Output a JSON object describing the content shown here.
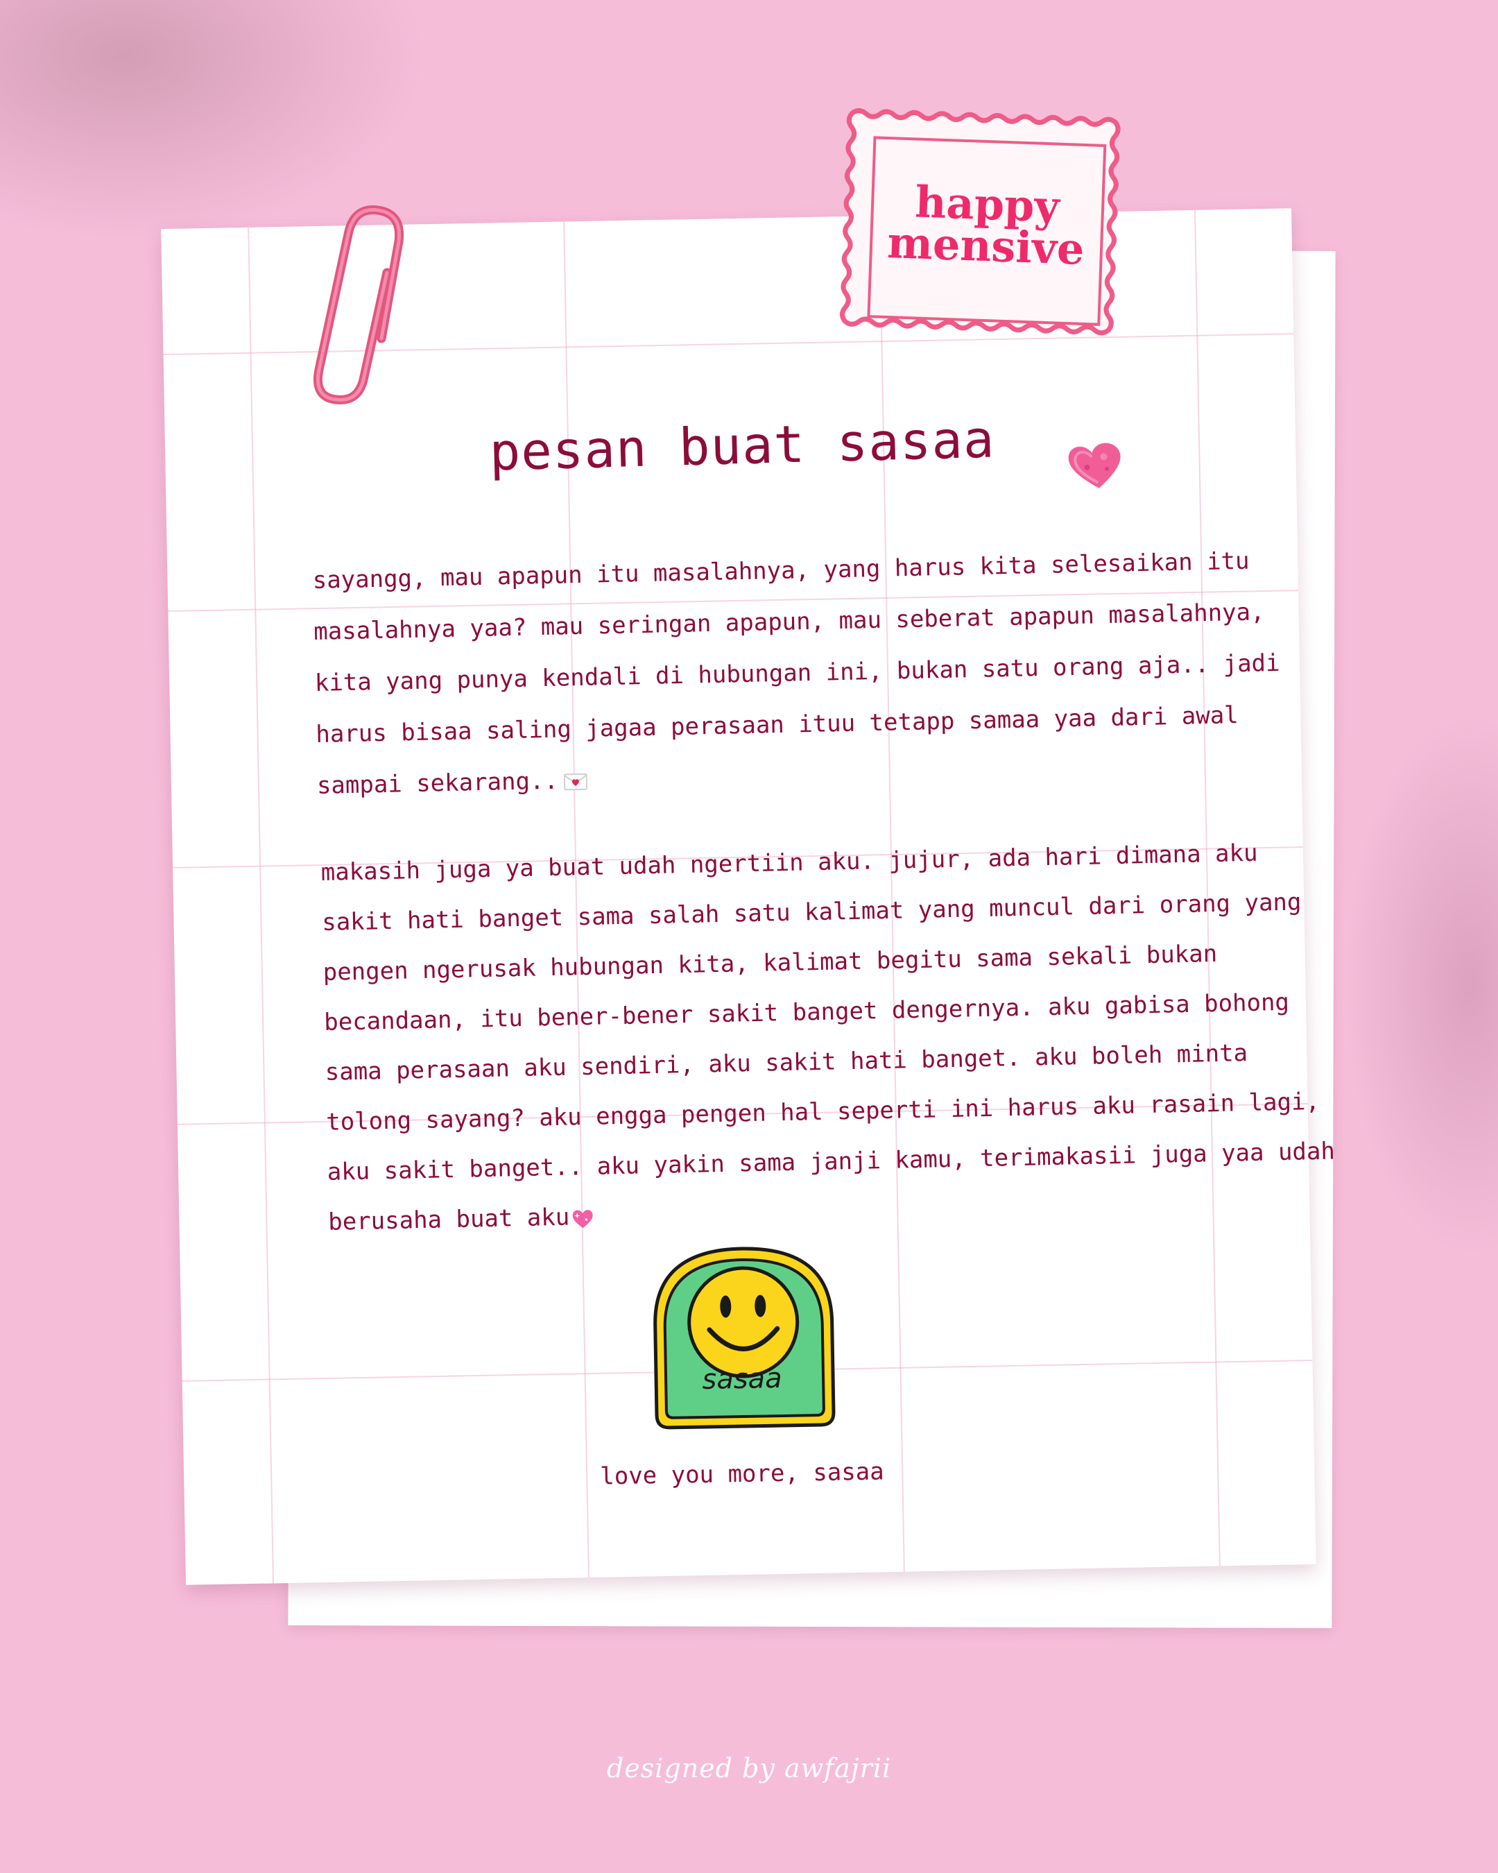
{
  "stamp": {
    "line1": "happy",
    "line2": "mensive",
    "color": "#ee2a6a"
  },
  "title": "pesan buat sasaa",
  "paragraph1": [
    "sayangg, mau apapun itu masalahnya, yang harus kita selesaikan itu",
    "masalahnya yaa? mau seringan apapun, mau seberat apapun masalahnya,",
    "kita yang punya kendali di hubungan ini, bukan satu orang aja.. jadi",
    "harus bisaa saling jagaa perasaan ituu tetapp samaa yaa dari awal",
    "sampai sekarang.."
  ],
  "paragraph2": [
    "makasih juga ya buat udah ngertiin aku. jujur, ada hari dimana aku",
    "sakit hati banget sama salah satu kalimat yang muncul dari orang yang",
    "pengen ngerusak hubungan kita, kalimat begitu sama sekali bukan",
    "becandaan, itu bener-bener sakit banget dengernya. aku gabisa bohong",
    "sama perasaan aku sendiri, aku sakit hati banget. aku boleh minta",
    "tolong sayang? aku engga pengen hal seperti ini harus aku rasain lagi,",
    "aku sakit banget.. aku yakin sama janji kamu, terimakasii juga yaa udah",
    "berusaha buat aku"
  ],
  "icons": {
    "paragraph1_end": "love-letter-icon",
    "paragraph2_end": "sparkling-heart-icon",
    "decor_heart": "heart-icon",
    "clip": "paperclip-icon",
    "sticker": "smiley-face-icon"
  },
  "sticker": {
    "label": "sasaa"
  },
  "closing": "love you more, sasaa",
  "credit": "designed by awfajrii",
  "colors": {
    "background": "#f6bdd9",
    "text": "#8c0d3a",
    "accent": "#ee2a6a"
  }
}
